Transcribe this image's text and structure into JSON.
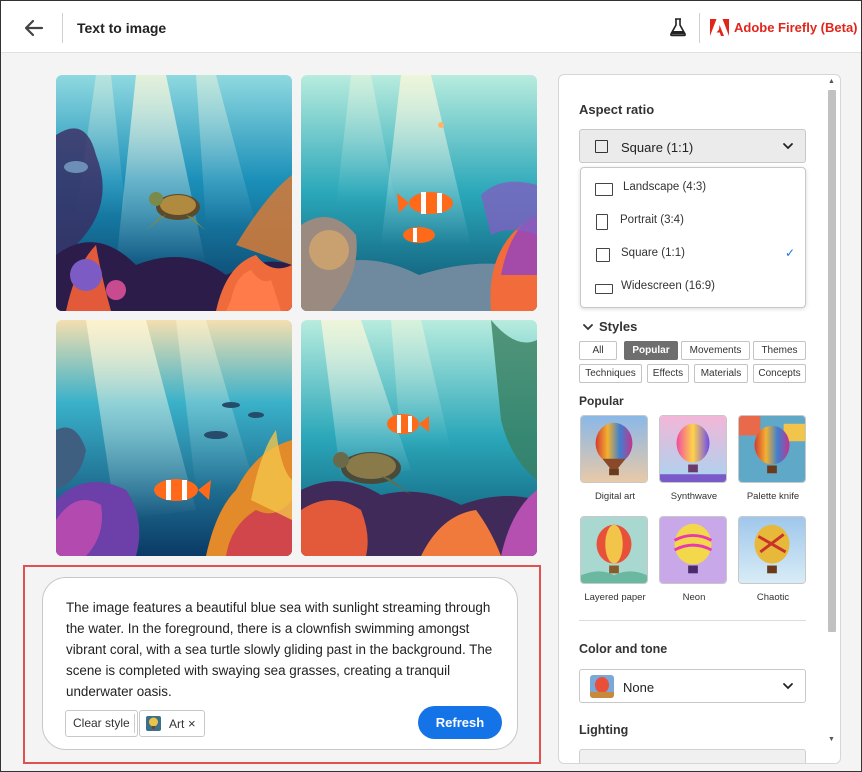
{
  "header": {
    "title": "Text to image",
    "brand": "Adobe Firefly (Beta)",
    "brand_color": "#e1251b"
  },
  "icons": [
    "back-arrow-icon",
    "beaker-icon",
    "adobe-logo-icon",
    "chevron-down-icon",
    "checkmark-icon",
    "close-icon"
  ],
  "images": [
    {
      "name": "Sea turtle with coral reef"
    },
    {
      "name": "Clownfish over reef"
    },
    {
      "name": "Clownfish in sunlit reef"
    },
    {
      "name": "Sea turtle and clownfish"
    }
  ],
  "prompt": {
    "text": "The image features a beautiful blue sea with sunlight streaming through the water. In the foreground, there is a clownfish swimming amongst vibrant coral, with a sea turtle slowly gliding past in the background. The scene is completed with swaying sea grasses, creating a tranquil underwater oasis.",
    "clear_style_label": "Clear style",
    "chip_label": "Art",
    "chip_close": "×",
    "refresh_label": "Refresh",
    "refresh_color": "#1473e6"
  },
  "panel": {
    "aspect_ratio": {
      "title": "Aspect ratio",
      "selected": "Square (1:1)",
      "options": [
        {
          "label": "Landscape (4:3)"
        },
        {
          "label": "Portrait (3:4)"
        },
        {
          "label": "Square (1:1)",
          "checked": "✓"
        },
        {
          "label": "Widescreen (16:9)"
        }
      ]
    },
    "styles": {
      "title": "Styles",
      "tabs": [
        "All",
        "Popular",
        "Movements",
        "Themes",
        "Techniques",
        "Effects",
        "Materials",
        "Concepts"
      ],
      "active_tab": "Popular",
      "section_title": "Popular",
      "items": [
        {
          "label": "Digital art"
        },
        {
          "label": "Synthwave"
        },
        {
          "label": "Palette knife"
        },
        {
          "label": "Layered paper"
        },
        {
          "label": "Neon"
        },
        {
          "label": "Chaotic"
        }
      ]
    },
    "color_tone": {
      "title": "Color and tone",
      "selected": "None"
    },
    "lighting": {
      "title": "Lighting"
    }
  }
}
